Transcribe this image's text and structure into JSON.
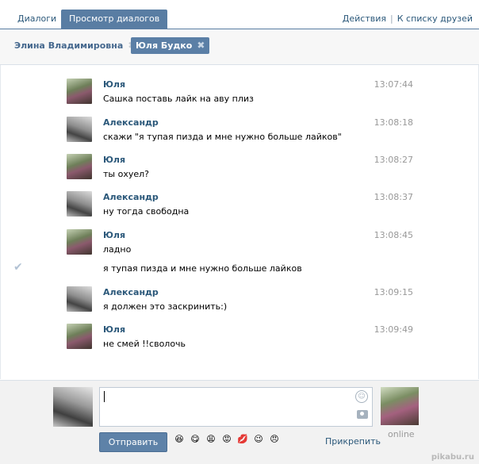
{
  "tabs": [
    {
      "label": "Диалоги",
      "active": false
    },
    {
      "label": "Просмотр диалогов",
      "active": true
    }
  ],
  "top_links": {
    "actions": "Действия",
    "to_friends": "К списку друзей",
    "separator": "|"
  },
  "dialog_chips": [
    {
      "name": "Элина Владимировна",
      "active": false
    },
    {
      "name": "Юля Будко",
      "active": true
    }
  ],
  "messages": [
    {
      "author": "Юля",
      "text": "Сашка поставь лайк на аву плиз",
      "time": "13:07:44",
      "avatar": "yulia"
    },
    {
      "author": "Александр",
      "text": "скажи \"я тупая пизда и мне нужно больше лайков\"",
      "time": "13:08:18",
      "avatar": "alex"
    },
    {
      "author": "Юля",
      "text": "ты охуел?",
      "time": "13:08:27",
      "avatar": "yulia"
    },
    {
      "author": "Александр",
      "text": "ну тогда свободна",
      "time": "13:08:37",
      "avatar": "alex"
    },
    {
      "author": "Юля",
      "text": "ладно",
      "time": "13:08:45",
      "avatar": "yulia"
    },
    {
      "author": "",
      "text": "я тупая пизда и мне нужно больше лайков",
      "time": "",
      "avatar": "",
      "checked": true
    },
    {
      "author": "Александр",
      "text": "я должен это заскринить:)",
      "time": "13:09:15",
      "avatar": "alex"
    },
    {
      "author": "Юля",
      "text": "не смей !!сволочь",
      "time": "13:09:49",
      "avatar": "yulia"
    }
  ],
  "composer": {
    "send_label": "Отправить",
    "attach_label": "Прикрепить",
    "status": "online",
    "emojis": [
      "😆",
      "😋",
      "😩",
      "😡",
      "💋",
      "😉",
      "😠"
    ]
  },
  "watermark": "pikabu.ru",
  "colors": {
    "accent": "#597da3",
    "link": "#2b587a",
    "time": "#999999"
  }
}
